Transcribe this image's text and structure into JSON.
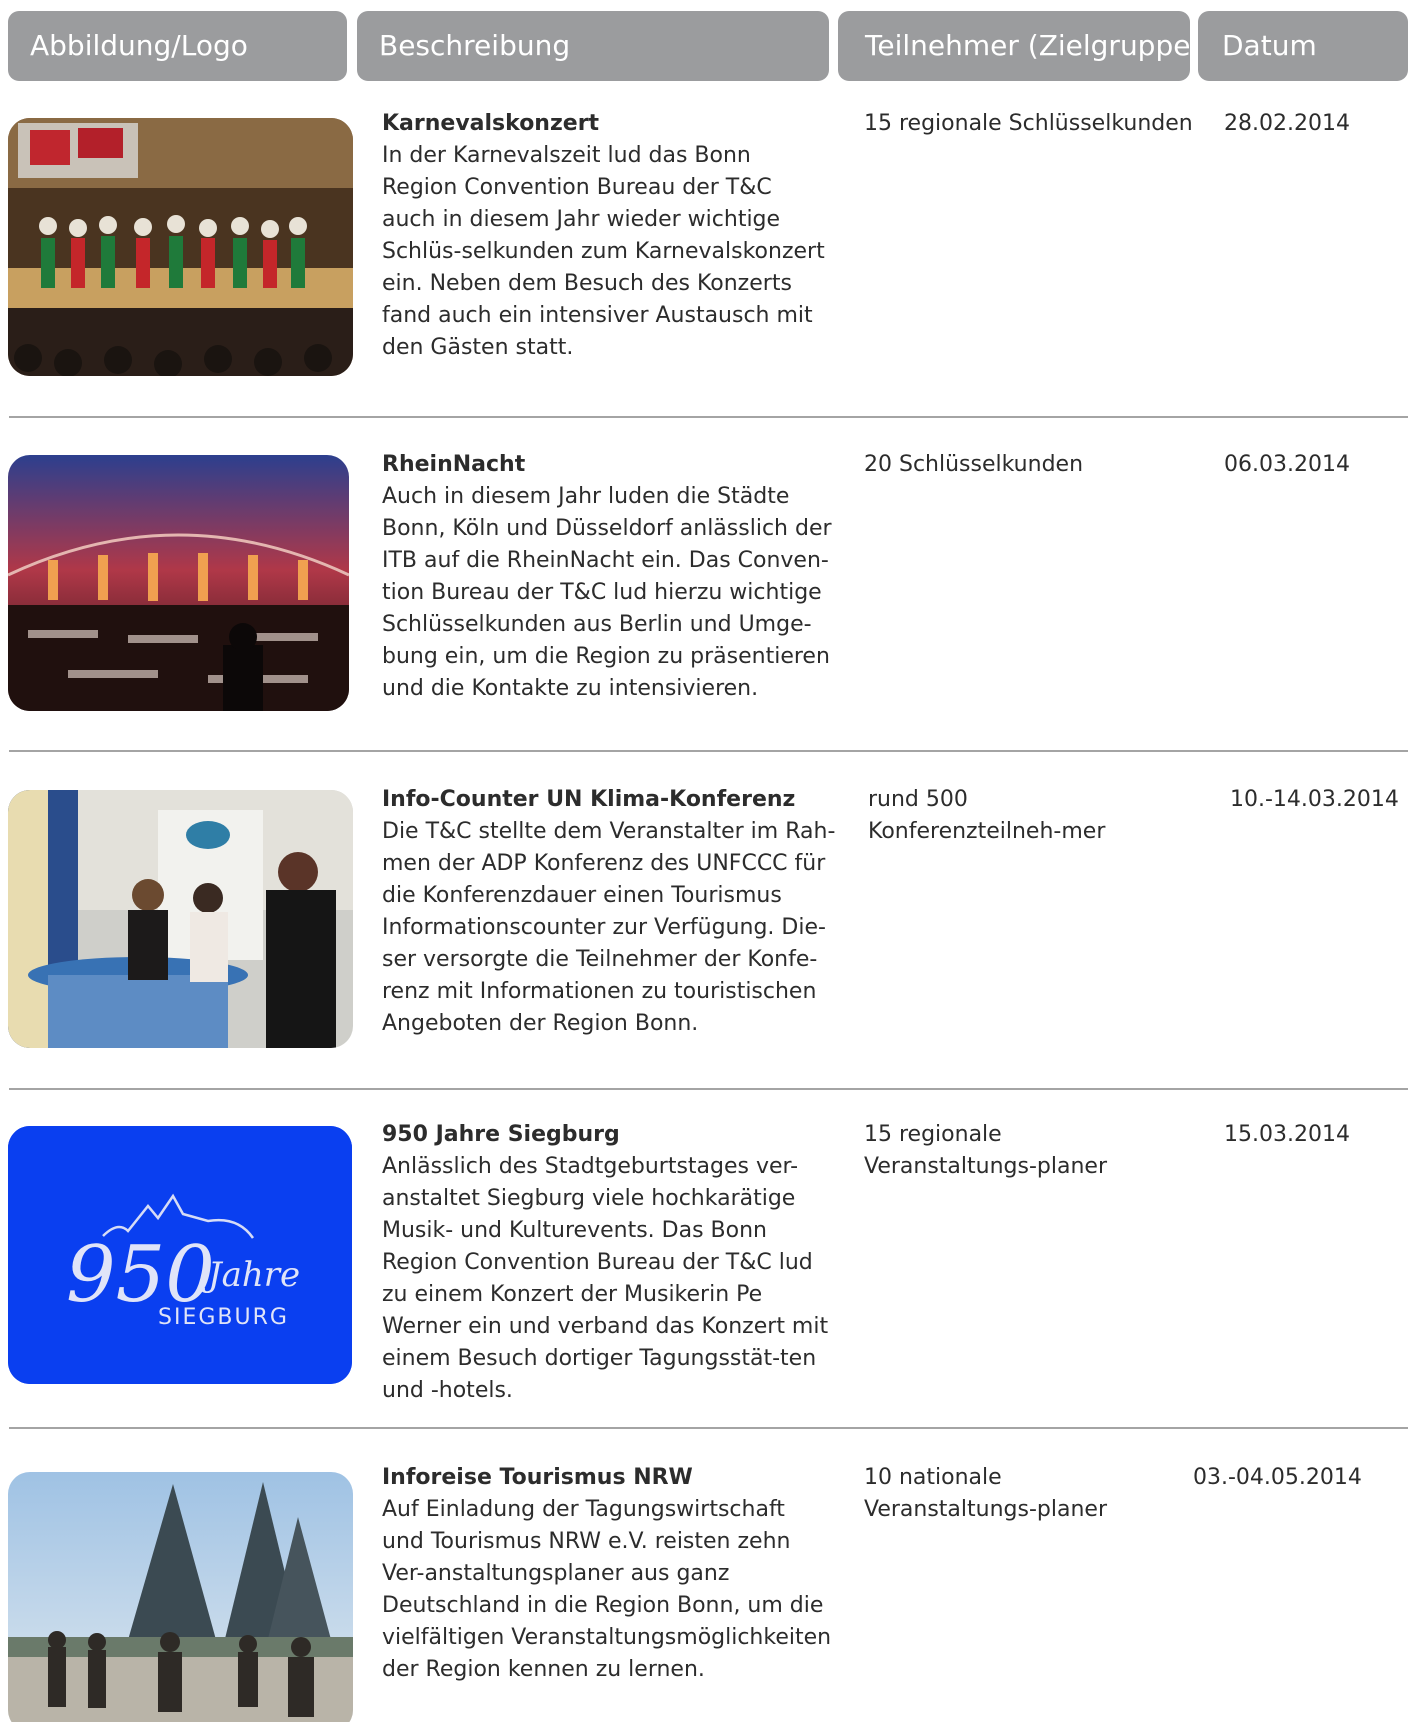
{
  "header": {
    "col_image": "Abbildung/Logo",
    "col_desc": "Beschreibung",
    "col_participants": "Teilnehmer (Zielgruppe)",
    "col_date": "Datum"
  },
  "rows": [
    {
      "title": "Karnevalskonzert",
      "text": "In der Karnevalszeit lud das Bonn Region Convention Bureau der T&C auch in diesem Jahr wieder wichtige Schlüs-selkunden zum Karnevalskonzert ein. Neben dem Besuch des Konzerts fand auch ein intensiver Austausch mit den Gästen statt.",
      "participants": "15 regionale Schlüsselkunden",
      "date": "28.02.2014"
    },
    {
      "title": "RheinNacht",
      "text": "Auch in diesem Jahr luden die Städte Bonn, Köln und Düsseldorf anlässlich der ITB auf die RheinNacht ein. Das Conven-tion Bureau der T&C lud hierzu wichtige Schlüsselkunden aus Berlin und Umge-bung ein, um die Region zu präsentieren und die Kontakte zu intensivieren.",
      "participants": "20 Schlüsselkunden",
      "date": "06.03.2014"
    },
    {
      "title": "Info-Counter UN Klima-Konferenz",
      "text": "Die T&C stellte dem Veranstalter im Rah-men der ADP Konferenz des UNFCCC für die Konferenzdauer einen Tourismus Informationscounter zur Verfügung. Die-ser versorgte die Teilnehmer der Konfe-renz mit Informationen zu touristischen Angeboten der Region Bonn.",
      "participants": "rund 500 Konferenzteilneh-mer",
      "date": "10.-14.03.2014"
    },
    {
      "title": "950 Jahre Siegburg",
      "text": "Anlässlich des Stadtgeburtstages ver-anstaltet Siegburg viele hochkarätige Musik- und Kulturevents. Das Bonn Region Convention Bureau der T&C lud zu einem Konzert der Musikerin Pe Werner ein und verband das Konzert mit einem Besuch dortiger Tagungsstät-ten und -hotels.",
      "participants": "15 regionale Veranstaltungs-planer",
      "date": "15.03.2014",
      "logo_number": "950",
      "logo_word": "Jahre",
      "logo_city": "SIEGBURG"
    },
    {
      "title": "Inforeise Tourismus NRW",
      "text": "Auf Einladung der Tagungswirtschaft und Tourismus NRW e.V. reisten zehn Ver-anstaltungsplaner aus ganz Deutschland in die Region Bonn, um die vielfältigen Veranstaltungsmöglichkeiten der Region kennen zu lernen.",
      "participants": "10 nationale Veranstaltungs-planer",
      "date": "03.-04.05.2014"
    }
  ],
  "colors": {
    "header_bg": "#9b9c9e",
    "header_text": "#ffffff",
    "separator": "#a4a4a4",
    "siegburg_blue": "#0a3ff0"
  }
}
